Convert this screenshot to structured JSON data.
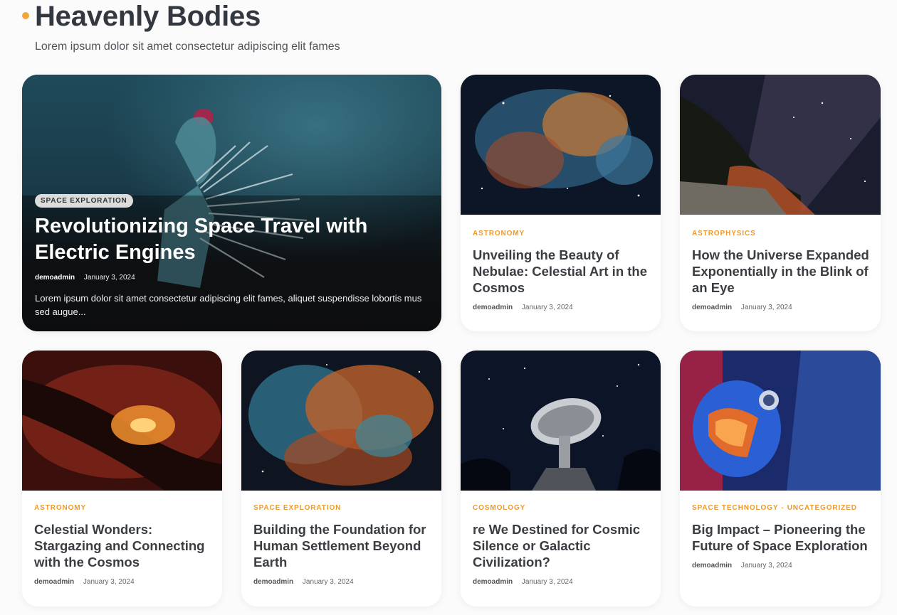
{
  "section": {
    "title": "Heavenly Bodies",
    "subtitle": "Lorem ipsum dolor sit amet consectetur adipiscing elit fames"
  },
  "hero": {
    "category": "SPACE EXPLORATION",
    "title": "Revolutionizing Space Travel with Electric Engines",
    "author": "demoadmin",
    "date": "January 3, 2024",
    "excerpt": "Lorem ipsum dolor sit amet consectetur adipiscing elit fames, aliquet suspendisse lobortis mus sed augue..."
  },
  "posts": [
    {
      "category": "ASTRONOMY",
      "title": "Unveiling the Beauty of Nebulae: Celestial Art in the Cosmos",
      "author": "demoadmin",
      "date": "January 3, 2024"
    },
    {
      "category": "ASTROPHYSICS",
      "title": "How the Universe Expanded Exponentially in the Blink of an Eye",
      "author": "demoadmin",
      "date": "January 3, 2024"
    },
    {
      "category": "ASTRONOMY",
      "title": "Celestial Wonders: Stargazing and Connecting with the Cosmos",
      "author": "demoadmin",
      "date": "January 3, 2024"
    },
    {
      "category": "SPACE EXPLORATION",
      "title": "Building the Foundation for Human Settlement Beyond Earth",
      "author": "demoadmin",
      "date": "January 3, 2024"
    },
    {
      "category": "COSMOLOGY",
      "title": "re We Destined for Cosmic Silence or Galactic Civilization?",
      "author": "demoadmin",
      "date": "January 3, 2024"
    },
    {
      "category": "SPACE TECHNOLOGY",
      "category2": "UNCATEGORIZED",
      "title": "Big Impact – Pioneering the Future of Space Exploration",
      "author": "demoadmin",
      "date": "January 3, 2024"
    }
  ],
  "colors": {
    "accent": "#ee9a2b",
    "heading": "#333740"
  }
}
